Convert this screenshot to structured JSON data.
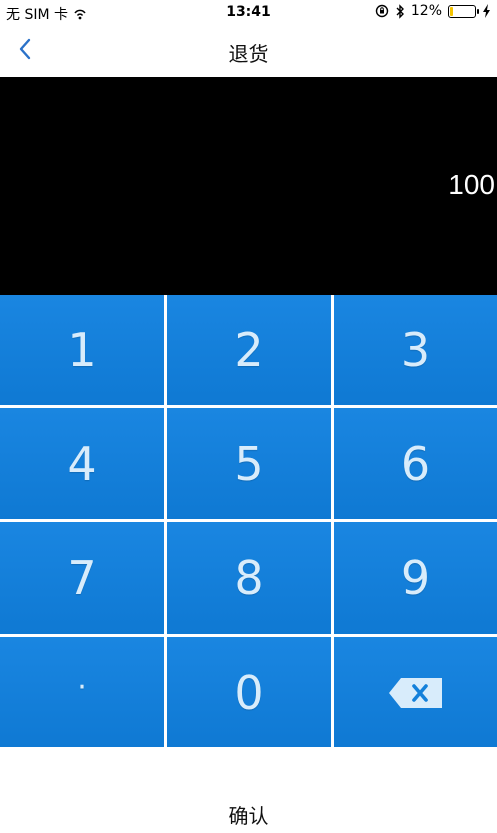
{
  "status_bar": {
    "carrier": "无 SIM 卡",
    "time": "13:41",
    "battery_percent": "12%",
    "battery_level": 0.12,
    "icons": [
      "wifi-icon",
      "orientation-lock-icon",
      "bluetooth-icon",
      "battery-icon",
      "charging-icon"
    ]
  },
  "nav": {
    "title": "退货",
    "back_icon": "chevron-left-icon"
  },
  "display": {
    "value": "100"
  },
  "keypad": {
    "keys": [
      "1",
      "2",
      "3",
      "4",
      "5",
      "6",
      "7",
      "8",
      "9",
      "·",
      "0"
    ],
    "backspace_icon": "backspace-icon"
  },
  "confirm": {
    "label": "确认"
  },
  "colors": {
    "keypad_blue": "#1380da",
    "key_text": "#d8ecfb",
    "accent": "#2b72c9"
  }
}
